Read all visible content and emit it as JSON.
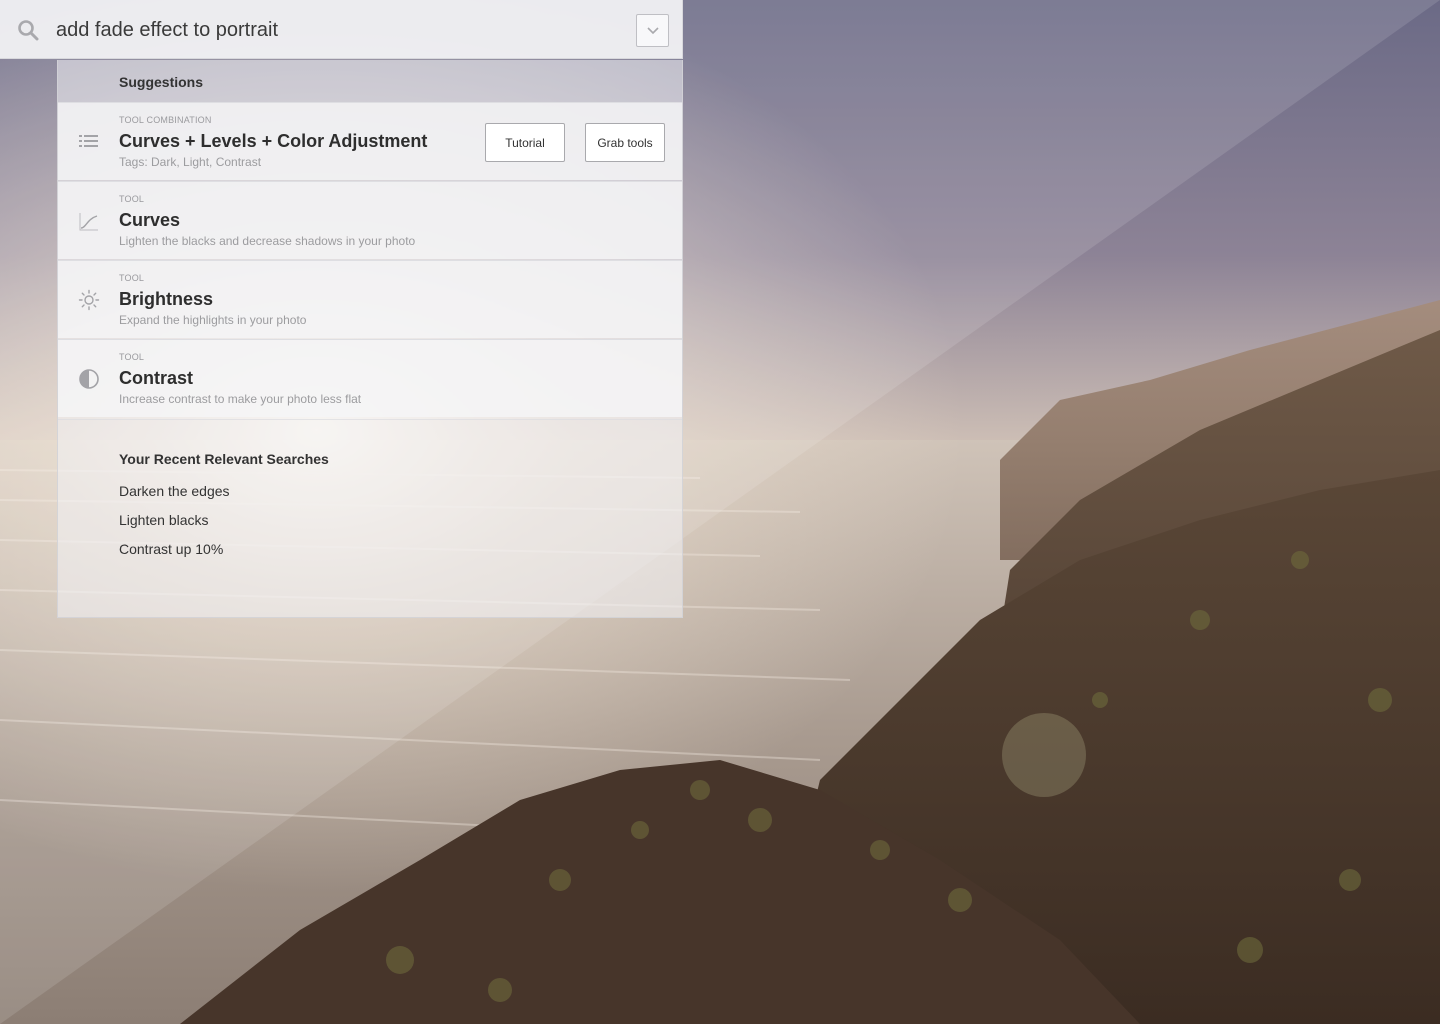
{
  "search": {
    "query": "add fade effect to portrait",
    "icons": {
      "search": "search-icon",
      "toggle": "chevron-down-icon"
    }
  },
  "suggestions": {
    "heading": "Suggestions",
    "combo": {
      "type": "TOOL COMBINATION",
      "title": "Curves + Levels + Color Adjustment",
      "tags": "Tags: Dark, Light, Contrast",
      "icon": "list-icon",
      "tutorial_label": "Tutorial",
      "grab_label": "Grab tools"
    },
    "tools": [
      {
        "type": "TOOL",
        "title": "Curves",
        "desc": "Lighten the blacks and decrease shadows in your photo",
        "icon": "curves-icon"
      },
      {
        "type": "TOOL",
        "title": "Brightness",
        "desc": "Expand the highlights in your photo",
        "icon": "sun-icon"
      },
      {
        "type": "TOOL",
        "title": "Contrast",
        "desc": "Increase contrast to make your photo less flat",
        "icon": "contrast-icon"
      }
    ]
  },
  "recent": {
    "heading": "Your Recent Relevant Searches",
    "items": [
      "Darken the edges",
      "Lighten blacks",
      "Contrast up 10%"
    ]
  },
  "colors": {
    "text_primary": "#2e2e2e",
    "text_secondary": "#9c9c9f",
    "panel_bg": "#f3f3f5"
  }
}
